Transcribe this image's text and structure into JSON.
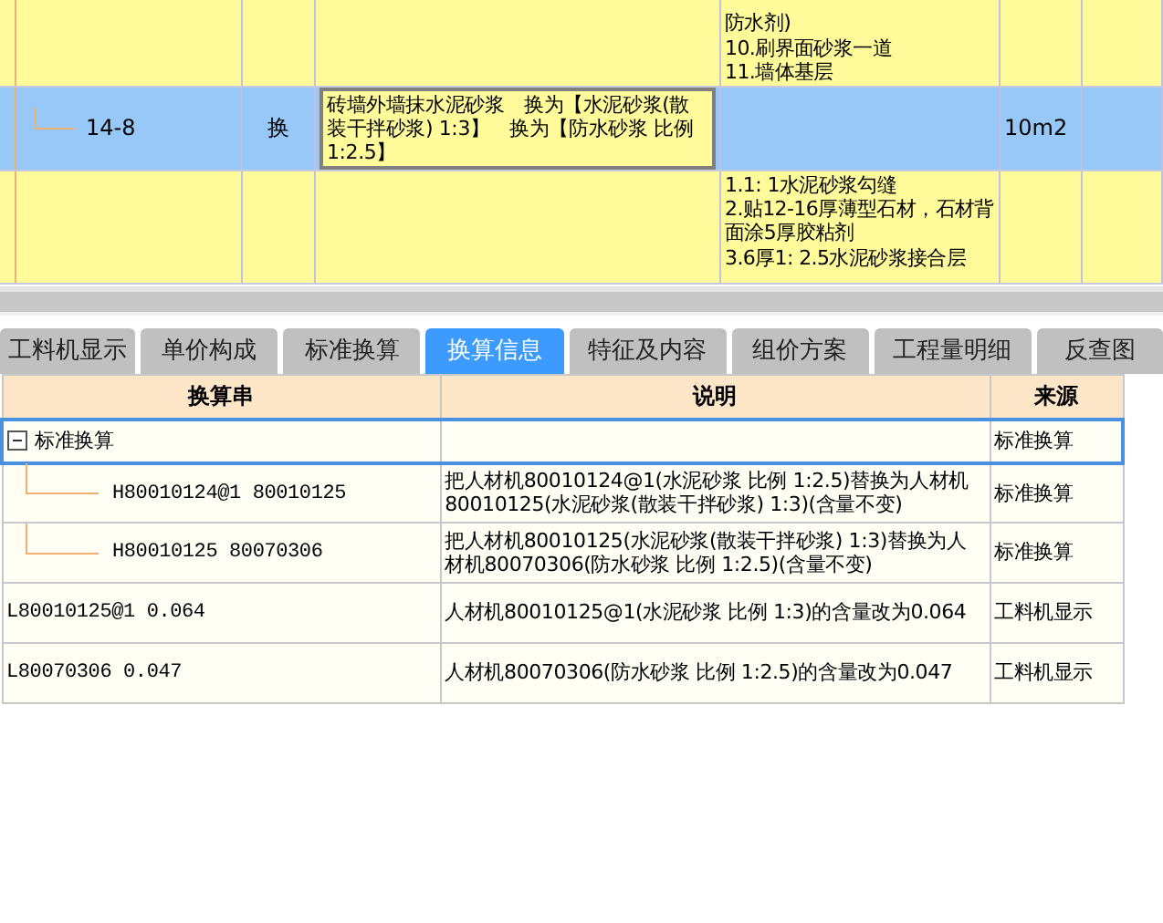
{
  "quota_rows": [
    {
      "selected": false,
      "features": [
        "防水剂)",
        "10.刷界面砂浆一道",
        "11.墙体基层"
      ]
    },
    {
      "selected": true,
      "code": "14-8",
      "type": "换",
      "name": "砖墙外墙抹水泥砂浆　换为【水泥砂浆(散装干拌砂浆) 1:3】　换为【防水砂浆 比例 1:2.5】",
      "unit": "10m2"
    },
    {
      "selected": false,
      "features": [
        "1.1: 1水泥砂浆勾缝",
        "2.贴12-16厚薄型石材，石材背面涂5厚胶粘剂",
        "3.6厚1: 2.5水泥砂浆接合层"
      ]
    }
  ],
  "tabs": [
    {
      "label": "工料机显示",
      "selected": false
    },
    {
      "label": "单价构成",
      "selected": false
    },
    {
      "label": "标准换算",
      "selected": false
    },
    {
      "label": "换算信息",
      "selected": true
    },
    {
      "label": "特征及内容",
      "selected": false
    },
    {
      "label": "组价方案",
      "selected": false
    },
    {
      "label": "工程量明细",
      "selected": false
    },
    {
      "label": "反查图",
      "selected": false
    }
  ],
  "detail_table": {
    "columns": [
      "换算串",
      "说明",
      "来源"
    ],
    "rows": [
      {
        "string": "标准换算",
        "source": "标准换算",
        "expanded": true,
        "selected": true,
        "children": [
          {
            "string": "H80010124@1 80010125",
            "description": "把人材机80010124@1(水泥砂浆 比例 1:2.5)替换为人材机80010125(水泥砂浆(散装干拌砂浆) 1:3)(含量不变)",
            "source": "标准换算",
            "selected": false
          },
          {
            "string": "H80010125 80070306",
            "description": "把人材机80010125(水泥砂浆(散装干拌砂浆) 1:3)替换为人材机80070306(防水砂浆 比例 1:2.5)(含量不变)",
            "source": "标准换算",
            "selected": false
          }
        ]
      },
      {
        "string": "L80010125@1 0.064",
        "description": "人材机80010125@1(水泥砂浆 比例 1:3)的含量改为0.064",
        "source": "工料机显示",
        "selected": false
      },
      {
        "string": "L80070306 0.047",
        "description": "人材机80070306(防水砂浆 比例 1:2.5)的含量改为0.047",
        "source": "工料机显示",
        "selected": false
      }
    ]
  }
}
